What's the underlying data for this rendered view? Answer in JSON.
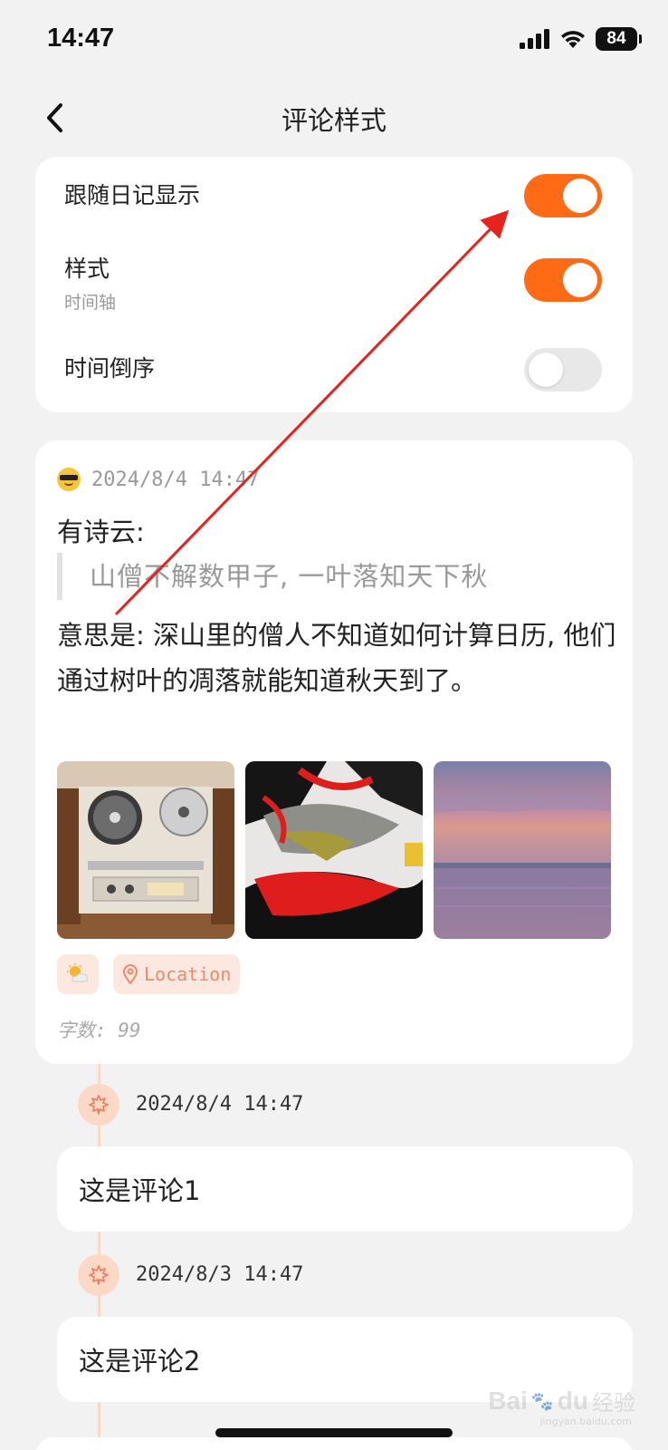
{
  "status_bar": {
    "time": "14:47",
    "battery": "84"
  },
  "nav": {
    "title": "评论样式"
  },
  "settings": [
    {
      "label": "跟随日记显示",
      "sublabel": "",
      "enabled": true
    },
    {
      "label": "样式",
      "sublabel": "时间轴",
      "enabled": true
    },
    {
      "label": "时间倒序",
      "sublabel": "",
      "enabled": false
    }
  ],
  "diary": {
    "date": "2024/8/4 14:47",
    "intro": "有诗云:",
    "quote": "山僧不解数甲子, 一叶落知天下秋",
    "meaning": "意思是: 深山里的僧人不知道如何计算日历, 他们通过树叶的凋落就能知道秋天到了。",
    "location_tag": "Location",
    "word_count": "字数: 99"
  },
  "comments": [
    {
      "date": "2024/8/4 14:47",
      "text": "这是评论1"
    },
    {
      "date": "2024/8/3 14:47",
      "text": "这是评论2"
    }
  ],
  "watermark": {
    "brand": "Bai",
    "brand_suffix": "du",
    "sub": "经验",
    "url": "jingyan.baidu.com"
  },
  "colors": {
    "accent": "#ff6a14",
    "tag_bg": "#fde8df",
    "timeline": "#fbd9c9",
    "annotation": "#e8231d"
  }
}
